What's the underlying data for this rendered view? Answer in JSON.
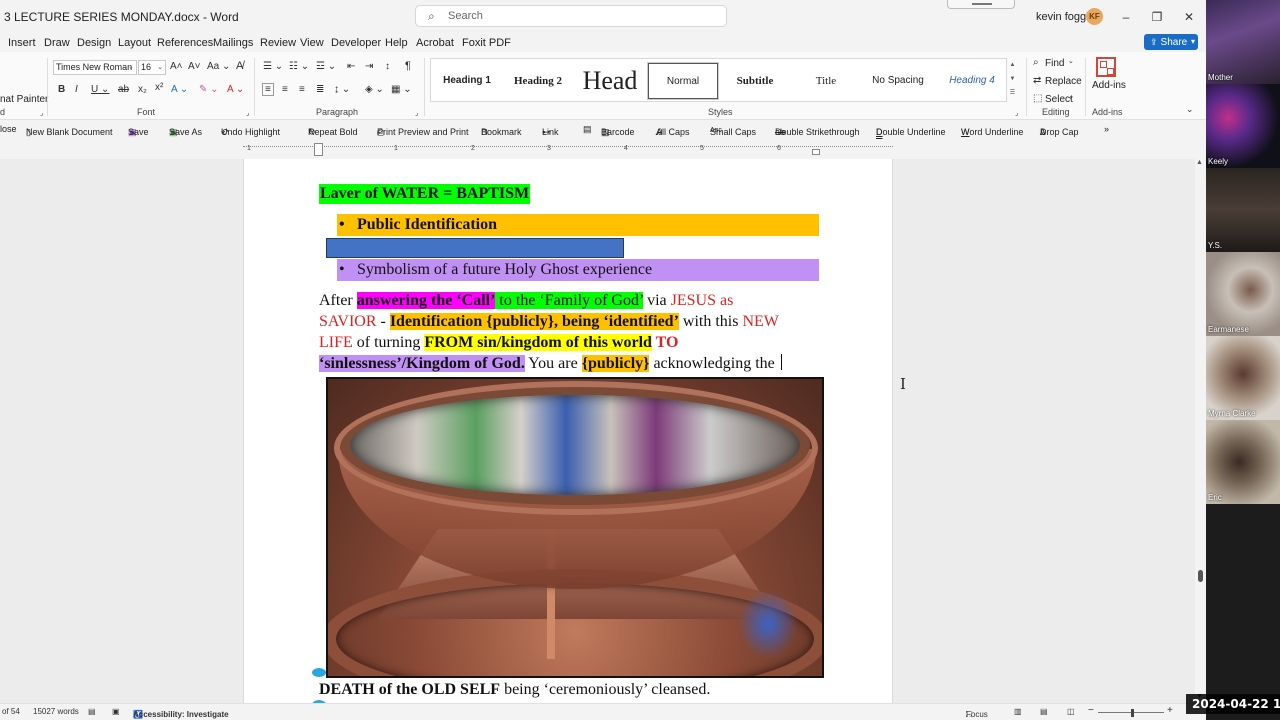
{
  "titlebar": {
    "doc_title": "3 LECTURE SERIES MONDAY.docx  -  Word",
    "search_placeholder": "Search",
    "user_name": "kevin foggie",
    "user_initials": "KF",
    "minimize": "–",
    "restore": "❐",
    "close": "✕"
  },
  "tabs": [
    "Insert",
    "Draw",
    "Design",
    "Layout",
    "References",
    "Mailings",
    "Review",
    "View",
    "Developer",
    "Help",
    "Acrobat",
    "Foxit PDF"
  ],
  "share_label": "Share",
  "ribbon": {
    "clipboard_partial": "nat Painter",
    "clipboard_group_partial": "d",
    "font_name": "Times New Roman",
    "font_size": "16",
    "font_group": "Font",
    "paragraph_group": "Paragraph",
    "styles_group": "Styles",
    "editing_group": "Editing",
    "addins_group": "Add-ins",
    "styles": [
      "Heading 1",
      "Heading 2",
      "Head",
      "Normal",
      "Subtitle",
      "Title",
      "No Spacing",
      "Heading 4"
    ],
    "active_style": "Normal",
    "find": "Find",
    "replace": "Replace",
    "select": "Select",
    "addins": "Add-ins"
  },
  "qat": {
    "close_partial": "lose",
    "items": [
      "New Blank Document",
      "Save",
      "Save As",
      "Undo Highlight",
      "Repeat Bold",
      "Print Preview and Print",
      "Bookmark",
      "Link",
      "Barcode",
      "All Caps",
      "Small Caps",
      "Double Strikethrough",
      "Double Underline",
      "Word Underline",
      "Drop Cap"
    ]
  },
  "ruler": {
    "numbers": [
      "1",
      "1",
      "2",
      "3",
      "4",
      "5",
      "6"
    ]
  },
  "document": {
    "heading": "Laver of WATER = BAPTISM",
    "bullet1": "Public Identification",
    "bullet2": "Symbolism of a future Holy Ghost experience",
    "bullet_char": "•",
    "para": {
      "l1_a": "After ",
      "l1_b": "answering the ‘Call’",
      "l1_c": " to the ‘Family of God’",
      "l1_d": " via ",
      "l1_e": "JESUS as",
      "l2_a": "SAVIOR",
      "l2_b": " - ",
      "l2_c": "Identification {publicly}, being ‘identified’",
      "l2_d": " with this ",
      "l2_e": "NEW",
      "l3_a": "LIFE",
      "l3_b": " of turning ",
      "l3_c": "FROM sin/kingdom of this world",
      "l3_d": " TO",
      "l4_a": "‘sinlessness’/Kingdom of God.",
      "l4_b": "  You are ",
      "l4_c": "{publicly}",
      "l4_d": " acknowledging the "
    },
    "after_image_bold": "DEATH of the OLD SELF",
    "after_image_rest": " being ‘ceremoniously’ cleansed."
  },
  "statusbar": {
    "page_partial": "of 54",
    "words": "15027 words",
    "accessibility": "Accessibility: Investigate",
    "focus": "Focus",
    "zoom_minus": "−",
    "zoom_plus": "+"
  },
  "participants": [
    "Mother",
    "Keely",
    "Y.S.",
    "Earmanese",
    "Myrna Clarke",
    "Eric"
  ],
  "timestamp": "2024-04-22  1"
}
